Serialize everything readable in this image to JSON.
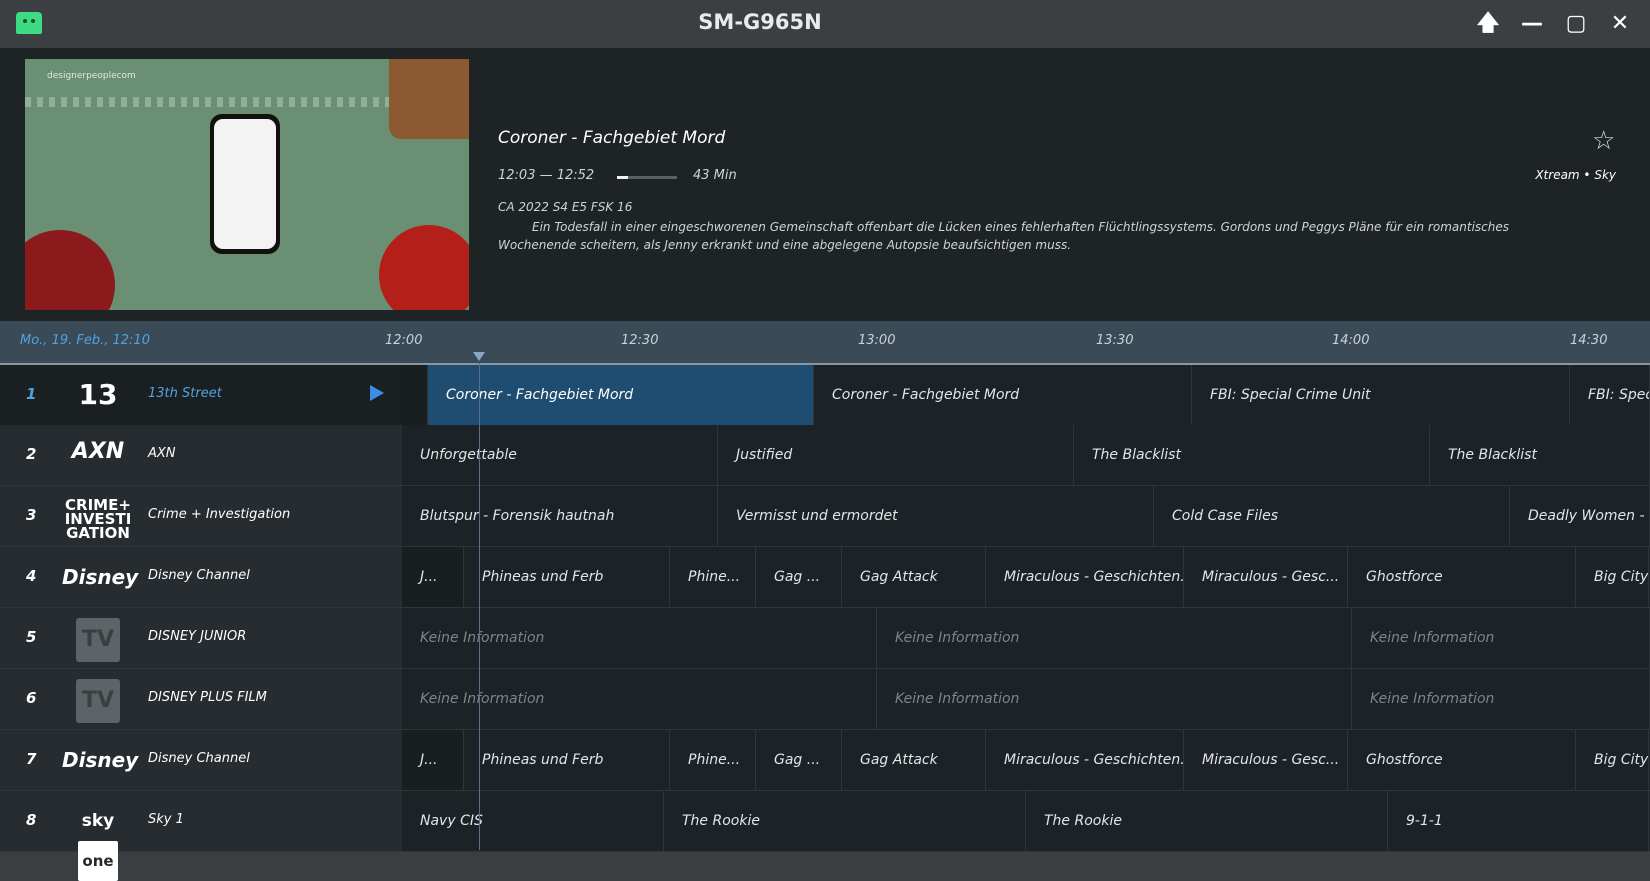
{
  "window": {
    "title": "SM-G965N",
    "up_glyph": "🡅",
    "min_glyph": "—",
    "max_glyph": "▢",
    "close_glyph": "✕"
  },
  "detail": {
    "watermark": "designerpeoplecom",
    "title": "Coroner - Fachgebiet Mord",
    "time": "12:03 — 12:52",
    "progress": 0.18,
    "minutes": "43 Min",
    "meta": "CA 2022 S4 E5 FSK 16",
    "description": "Ein Todesfall in einer eingeschworenen Gemeinschaft offenbart die Lücken eines fehlerhaften Flüchtlingssystems. Gordons und Peggys Pläne für ein romantisches Wochenende scheitern, als Jenny erkrankt und eine abgelegene Autopsie beaufsichtigen muss.",
    "source": "Xtream  •  Sky",
    "star_glyph": "☆"
  },
  "timeline": {
    "date": "Mo., 19. Feb., 12:10",
    "ticks": [
      "12:00",
      "12:30",
      "13:00",
      "13:30",
      "14:00",
      "14:30"
    ]
  },
  "channels": [
    {
      "num": "1",
      "logo": "13th",
      "name": "13th Street",
      "programs": [
        {
          "title": "",
          "style": "dark"
        },
        {
          "title": "Coroner - Fachgebiet Mord",
          "style": "sel"
        },
        {
          "title": "Coroner - Fachgebiet Mord"
        },
        {
          "title": "FBI: Special Crime Unit"
        },
        {
          "title": "FBI: Spec"
        }
      ]
    },
    {
      "num": "2",
      "logo": "AXN",
      "name": "AXN",
      "programs": [
        {
          "title": "Unforgettable"
        },
        {
          "title": "Justified"
        },
        {
          "title": "The Blacklist"
        },
        {
          "title": "The Blacklist"
        }
      ]
    },
    {
      "num": "3",
      "logo": "CRIME+",
      "name": "Crime + Investigation",
      "programs": [
        {
          "title": "Blutspur - Forensik hautnah"
        },
        {
          "title": "Vermisst und ermordet"
        },
        {
          "title": "Cold Case Files"
        },
        {
          "title": "Deadly Women - H"
        }
      ]
    },
    {
      "num": "4",
      "logo": "Disney",
      "name": "Disney Channel",
      "programs": [
        {
          "title": "J...",
          "style": "dark"
        },
        {
          "title": "Phineas und Ferb"
        },
        {
          "title": "Phine..."
        },
        {
          "title": "Gag ..."
        },
        {
          "title": "Gag Attack"
        },
        {
          "title": "Miraculous - Geschichten..."
        },
        {
          "title": "Miraculous - Gesc..."
        },
        {
          "title": "Ghostforce"
        },
        {
          "title": "Big City"
        }
      ]
    },
    {
      "num": "5",
      "logo": "TV",
      "name": "DISNEY JUNIOR",
      "programs": [
        {
          "title": "Keine Information",
          "style": "noinfo"
        },
        {
          "title": "Keine Information",
          "style": "noinfo"
        },
        {
          "title": "Keine Information",
          "style": "noinfo"
        }
      ]
    },
    {
      "num": "6",
      "logo": "TV",
      "name": "DISNEY PLUS FILM",
      "programs": [
        {
          "title": "Keine Information",
          "style": "noinfo"
        },
        {
          "title": "Keine Information",
          "style": "noinfo"
        },
        {
          "title": "Keine Information",
          "style": "noinfo"
        }
      ]
    },
    {
      "num": "7",
      "logo": "Disney",
      "name": "Disney Channel",
      "programs": [
        {
          "title": "J...",
          "style": "dark"
        },
        {
          "title": "Phineas und Ferb"
        },
        {
          "title": "Phine..."
        },
        {
          "title": "Gag ..."
        },
        {
          "title": "Gag Attack"
        },
        {
          "title": "Miraculous - Geschichten..."
        },
        {
          "title": "Miraculous - Gesc..."
        },
        {
          "title": "Ghostforce"
        },
        {
          "title": "Big City"
        }
      ]
    },
    {
      "num": "8",
      "logo": "sky one",
      "name": "Sky 1",
      "programs": [
        {
          "title": "Navy CIS"
        },
        {
          "title": "The Rookie"
        },
        {
          "title": "The Rookie"
        },
        {
          "title": "9-1-1"
        }
      ]
    }
  ]
}
